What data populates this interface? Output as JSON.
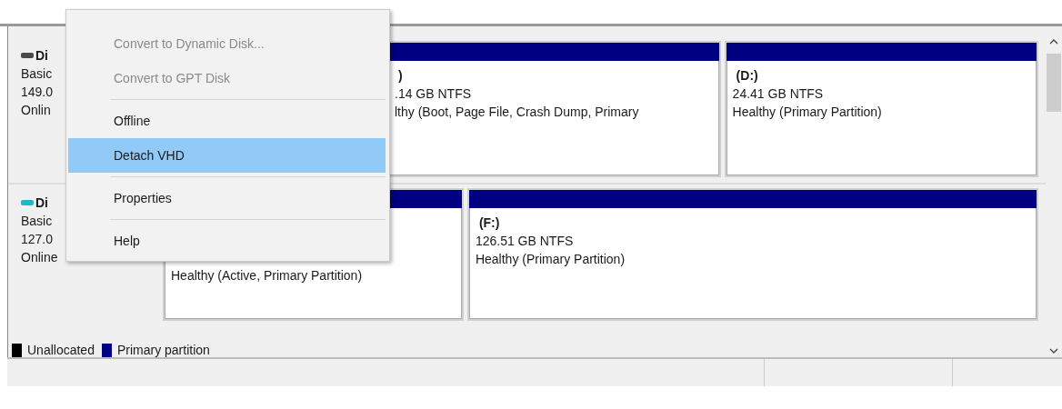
{
  "disks": [
    {
      "kind": "disk",
      "name": "Di",
      "type": "Basic",
      "size": "149.0",
      "status": "Onlin",
      "partitions": [
        {
          "label": ")",
          "size": ".14 GB NTFS",
          "status": "lthy (Boot, Page File, Crash Dump, Primary"
        },
        {
          "label": "(D:)",
          "size": "24.41 GB NTFS",
          "status": "Healthy (Primary Partition)"
        }
      ]
    },
    {
      "kind": "vhd",
      "name": "Di",
      "type": "Basic",
      "size": "127.0",
      "status": "Online",
      "partitions": [
        {
          "status": "Healthy (Active, Primary Partition)"
        },
        {
          "label": "(F:)",
          "size": "126.51 GB NTFS",
          "status": "Healthy (Primary Partition)"
        }
      ]
    }
  ],
  "legend": [
    {
      "label": "Unallocated",
      "color": "#000000"
    },
    {
      "label": "Primary partition",
      "color": "#000080"
    }
  ],
  "context_menu": [
    {
      "items": [
        {
          "label": "Convert to Dynamic Disk...",
          "disabled": true,
          "selected": false
        },
        {
          "label": "Convert to GPT Disk",
          "disabled": true,
          "selected": false
        }
      ]
    },
    {
      "items": [
        {
          "label": "Offline",
          "disabled": false,
          "selected": false
        },
        {
          "label": "Detach VHD",
          "disabled": false,
          "selected": true
        }
      ]
    },
    {
      "items": [
        {
          "label": "Properties",
          "disabled": false,
          "selected": false
        }
      ]
    },
    {
      "items": [
        {
          "label": "Help",
          "disabled": false,
          "selected": false
        }
      ]
    }
  ]
}
